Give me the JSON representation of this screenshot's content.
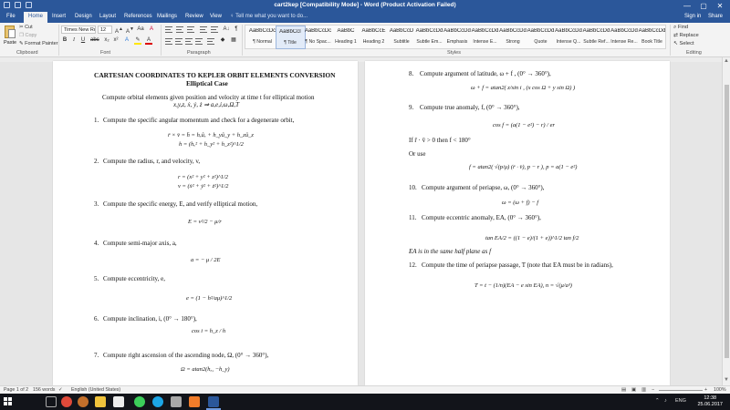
{
  "window": {
    "title": "cart2kep [Compatibility Mode] - Word (Product Activation Failed)",
    "controls": [
      "—",
      "▢",
      "✕"
    ]
  },
  "tabs": [
    "File",
    "Home",
    "Insert",
    "Design",
    "Layout",
    "References",
    "Mailings",
    "Review",
    "View"
  ],
  "tell_me": "Tell me what you want to do...",
  "account": {
    "sign_in": "Sign in",
    "share": "Share"
  },
  "ribbon": {
    "clipboard": {
      "paste": "Paste",
      "cut": "Cut",
      "copy": "Copy",
      "format_painter": "Format Painter",
      "label": "Clipboard"
    },
    "font": {
      "name": "Times New Ro",
      "size": "12",
      "label": "Font"
    },
    "paragraph": {
      "label": "Paragraph"
    },
    "styles": {
      "label": "Styles",
      "items": [
        {
          "preview": "AaBbCcDc",
          "name": "¶ Normal"
        },
        {
          "preview": "AaBbCcI",
          "name": "¶ Title"
        },
        {
          "preview": "AaBbCcDc",
          "name": "¶ No Spac..."
        },
        {
          "preview": "AaBbC",
          "name": "Heading 1"
        },
        {
          "preview": "AaBbCcE",
          "name": "Heading 2"
        },
        {
          "preview": "AaBbCcD",
          "name": "Subtitle"
        },
        {
          "preview": "AaBbCcDd",
          "name": "Subtle Em..."
        },
        {
          "preview": "AaBbCcDd",
          "name": "Emphasis"
        },
        {
          "preview": "AaBbCcDd",
          "name": "Intense E..."
        },
        {
          "preview": "AaBbCcDd",
          "name": "Strong"
        },
        {
          "preview": "AaBbCcDd",
          "name": "Quote"
        },
        {
          "preview": "AaBbCcDd",
          "name": "Intense Q..."
        },
        {
          "preview": "AaBbCcDd",
          "name": "Subtle Ref..."
        },
        {
          "preview": "AaBbCcDd",
          "name": "Intense Re..."
        },
        {
          "preview": "AaBbCcDd",
          "name": "Book Title"
        }
      ]
    },
    "editing": {
      "find": "Find",
      "replace": "Replace",
      "select": "Select",
      "label": "Editing"
    }
  },
  "page_left": {
    "title": "CARTESIAN COORDINATES TO KEPLER ORBIT ELEMENTS CONVERSION",
    "subtitle": "Elliptical Case",
    "intro": "Compute orbital elements given position and velocity at time t for elliptical motion",
    "intro_vars": "x,y,z, ẋ, ẏ, ż ⇒ a,e,i,ω,Ω,T",
    "steps": [
      {
        "n": "1.",
        "text": "Compute the specific angular momentum and check for a degenerate orbit,",
        "eq": [
          "r̄ × v̄ = h̄ = hₓûₓ + h_yû_y + h_zû_z",
          "h = (hₓ² + h_y² + h_z²)^1/2"
        ]
      },
      {
        "n": "2.",
        "text": "Compute the radius, r, and velocity, v,",
        "eq": [
          "r = (x² + y² + z²)^1/2",
          "v = (ẋ² + ẏ² + ż²)^1/2"
        ]
      },
      {
        "n": "3.",
        "text": "Compute the specific energy, E, and verify elliptical motion,",
        "eq": [
          "E = v²/2 − μ/r"
        ]
      },
      {
        "n": "4.",
        "text": "Compute semi-major axis, a,",
        "eq": [
          "a = − μ / 2E"
        ]
      },
      {
        "n": "5.",
        "text": "Compute eccentricity, e,",
        "eq": [
          "e = (1 − h²/aμ)^1/2"
        ]
      },
      {
        "n": "6.",
        "text": "Compute inclination, i, (0° → 180°),",
        "eq": [
          "cos i = h_z / h"
        ]
      },
      {
        "n": "7.",
        "text": "Compute right ascension of the ascending node, Ω, (0° → 360°),",
        "eq": [
          "Ω = atan2(hₓ, −h_y)"
        ]
      }
    ]
  },
  "page_right": {
    "steps": [
      {
        "n": "8.",
        "text": "Compute argument of latitude, ω + f , (0° → 360°),",
        "eq": [
          "ω + f = atan2( z/sin i , (x cos Ω + y sin Ω) )"
        ]
      },
      {
        "n": "9.",
        "text": "Compute true anomaly, f, (0° → 360°),",
        "eq": [
          "cos f = (a(1 − e²) − r) / er"
        ],
        "notes": [
          "If r̄ · v̄ > 0 then f < 180°",
          "Or use"
        ],
        "eq2": "f = atan2( √(p/μ) (r̄ · v̄), p − r ),  p = a(1 − e²)"
      },
      {
        "n": "10.",
        "text": "Compute argument of periapse, ω, (0° → 360°),",
        "eq": [
          "ω = (ω + f) − f"
        ]
      },
      {
        "n": "11.",
        "text": "Compute eccentric anomaly, EA, (0° → 360°),",
        "eq": [
          "tan EA/2 = ((1 − e)/(1 + e))^1/2 tan f/2"
        ],
        "notes": [
          "EA is in the same half plane as f"
        ]
      },
      {
        "n": "12.",
        "text": "Compute the time of periapse passage, T (note that EA must be in radians),",
        "eq": [
          "T = t − (1/n)(EA − e sin EA),    n = √(μ/a³)"
        ]
      }
    ]
  },
  "status": {
    "page": "Page 1 of 2",
    "words": "156 words",
    "language": "English (United States)",
    "zoom": "100%"
  },
  "taskbar": {
    "time": "12:38",
    "date": "25.06.2017",
    "lang": "ENG",
    "apps": [
      "start-button",
      "task-view",
      "chrome",
      "file-explorer",
      "whatsapp",
      "skype",
      "store",
      "app-7",
      "app-8",
      "app-9",
      "word"
    ]
  }
}
